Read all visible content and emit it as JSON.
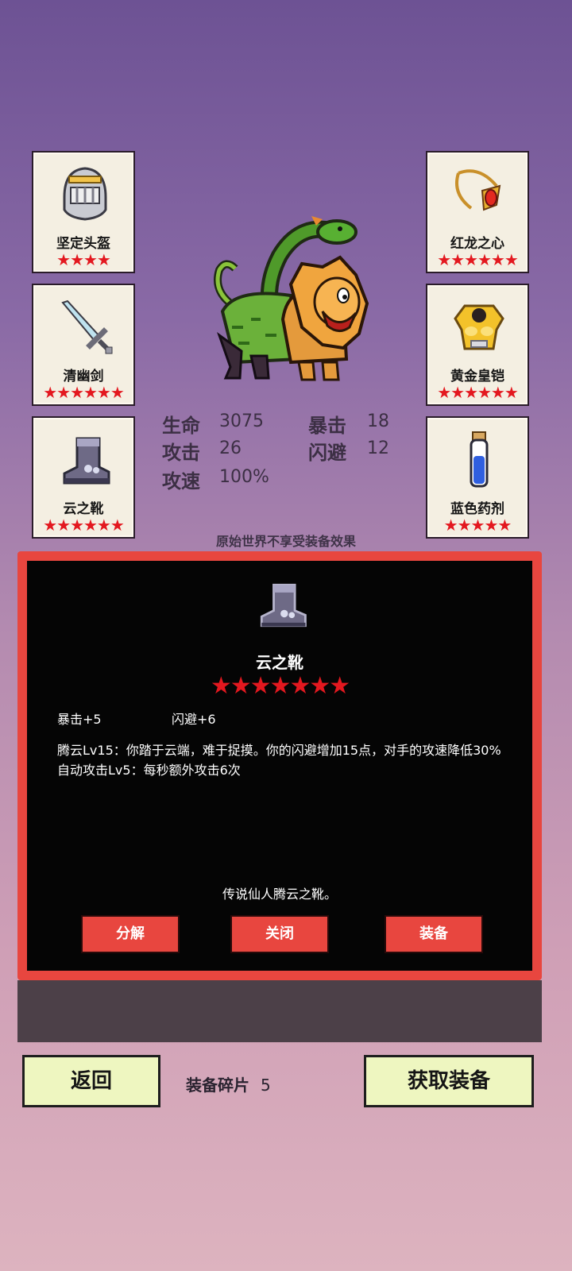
{
  "slots": {
    "left": [
      {
        "name": "坚定头盔",
        "stars": "★★★★",
        "icon": "helmet-icon"
      },
      {
        "name": "清幽剑",
        "stars": "★★★★★★",
        "icon": "sword-icon"
      },
      {
        "name": "云之靴",
        "stars": "★★★★★★",
        "icon": "boots-icon"
      }
    ],
    "right": [
      {
        "name": "红龙之心",
        "stars": "★★★★★★",
        "icon": "amulet-icon"
      },
      {
        "name": "黄金皇铠",
        "stars": "★★★★★★",
        "icon": "gold-armor-icon"
      },
      {
        "name": "蓝色药剂",
        "stars": "★★★★★",
        "icon": "potion-icon"
      }
    ]
  },
  "monster": {
    "icon": "chimera-icon"
  },
  "stats": {
    "hp_label": "生命",
    "hp_value": "3075",
    "atk_label": "攻击",
    "atk_value": "26",
    "spd_label": "攻速",
    "spd_value": "100%",
    "crit_label": "暴击",
    "crit_value": "18",
    "dodge_label": "闪避",
    "dodge_value": "12"
  },
  "notice": "原始世界不享受装备效果",
  "dialog": {
    "item_name": "云之靴",
    "stars": "★★★★★★★",
    "bonus1": "暴击+5",
    "bonus2": "闪避+6",
    "skill1": "腾云Lv15：你踏于云端，难于捉摸。你的闪避增加15点，对手的攻速降低30%",
    "skill2": "自动攻击Lv5：每秒额外攻击6次",
    "flavor": "传说仙人腾云之靴。",
    "btn_decompose": "分解",
    "btn_close": "关闭",
    "btn_equip": "装备"
  },
  "footer": {
    "back": "返回",
    "fragments_label": "装备碎片",
    "fragments_value": "5",
    "obtain": "获取装备"
  },
  "colors": {
    "accent_red": "#e8463f",
    "star_red": "#e3181f",
    "button_green": "#eef6c0"
  }
}
